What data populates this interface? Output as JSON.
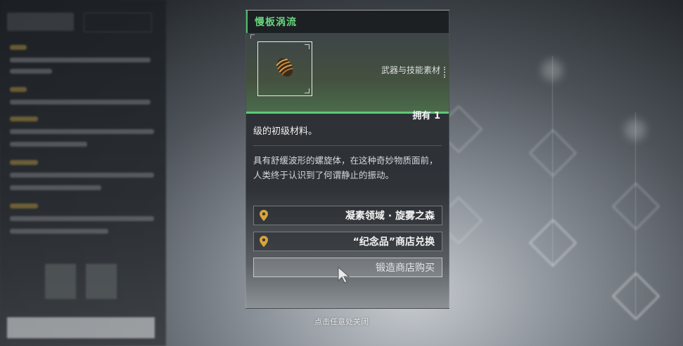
{
  "item": {
    "name": "慢板涡流",
    "category": "武器与技能素材",
    "owned": "拥有 1",
    "short_desc": "级的初级材料。",
    "long_desc": "具有舒缓波形的螺旋体，在这种奇妙物质面前，人类终于认识到了何谓静止的振动。"
  },
  "sources": [
    {
      "label": "凝素领域 · 旋雾之森",
      "icon": "location-pin-icon",
      "enabled": true
    },
    {
      "label": "“纪念品”商店兑换",
      "icon": "location-pin-icon",
      "enabled": true
    },
    {
      "label": "锻造商店购买",
      "icon": "",
      "enabled": false
    }
  ],
  "hint": "点击任意处关闭",
  "colors": {
    "accent_green": "#69d37f",
    "pin_gold": "#d9a43a"
  }
}
